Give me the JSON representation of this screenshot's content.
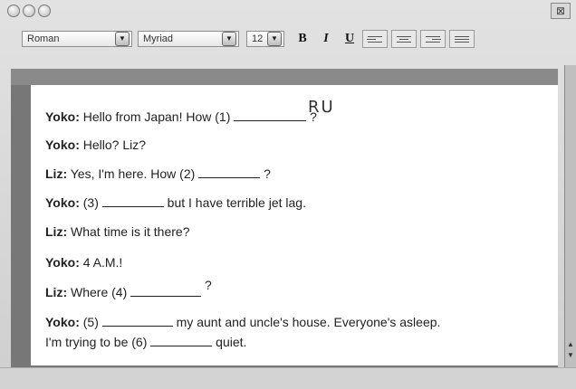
{
  "toolbar": {
    "style_select": "Roman",
    "font_select": "Myriad",
    "size_select": "12",
    "bold_label": "B",
    "italic_label": "I",
    "underline_label": "U"
  },
  "dialog": [
    {
      "speaker": "Yoko:",
      "text": "Hello from Japan! How (1)",
      "after": "?"
    },
    {
      "speaker": "Yoko:",
      "text": "Hello? Liz?"
    },
    {
      "speaker": "Liz:",
      "text": "Yes, I'm here. How (2)",
      "after": "?"
    },
    {
      "speaker": "Yoko:",
      "text": "(3)",
      "after": "but I have terrible jet lag."
    },
    {
      "speaker": "Liz:",
      "text": "What time is it there?"
    },
    {
      "speaker": "Yoko:",
      "text": "4 A.M.!"
    },
    {
      "speaker": "Liz:",
      "text": "Where (4)",
      "after": "?"
    },
    {
      "speaker": "Yoko:",
      "text": "(5)",
      "after": "my aunt and uncle's house. Everyone's asleep."
    },
    {
      "text": "I'm trying to be (6)",
      "after": "quiet."
    }
  ],
  "handwritten_answer": "RU"
}
